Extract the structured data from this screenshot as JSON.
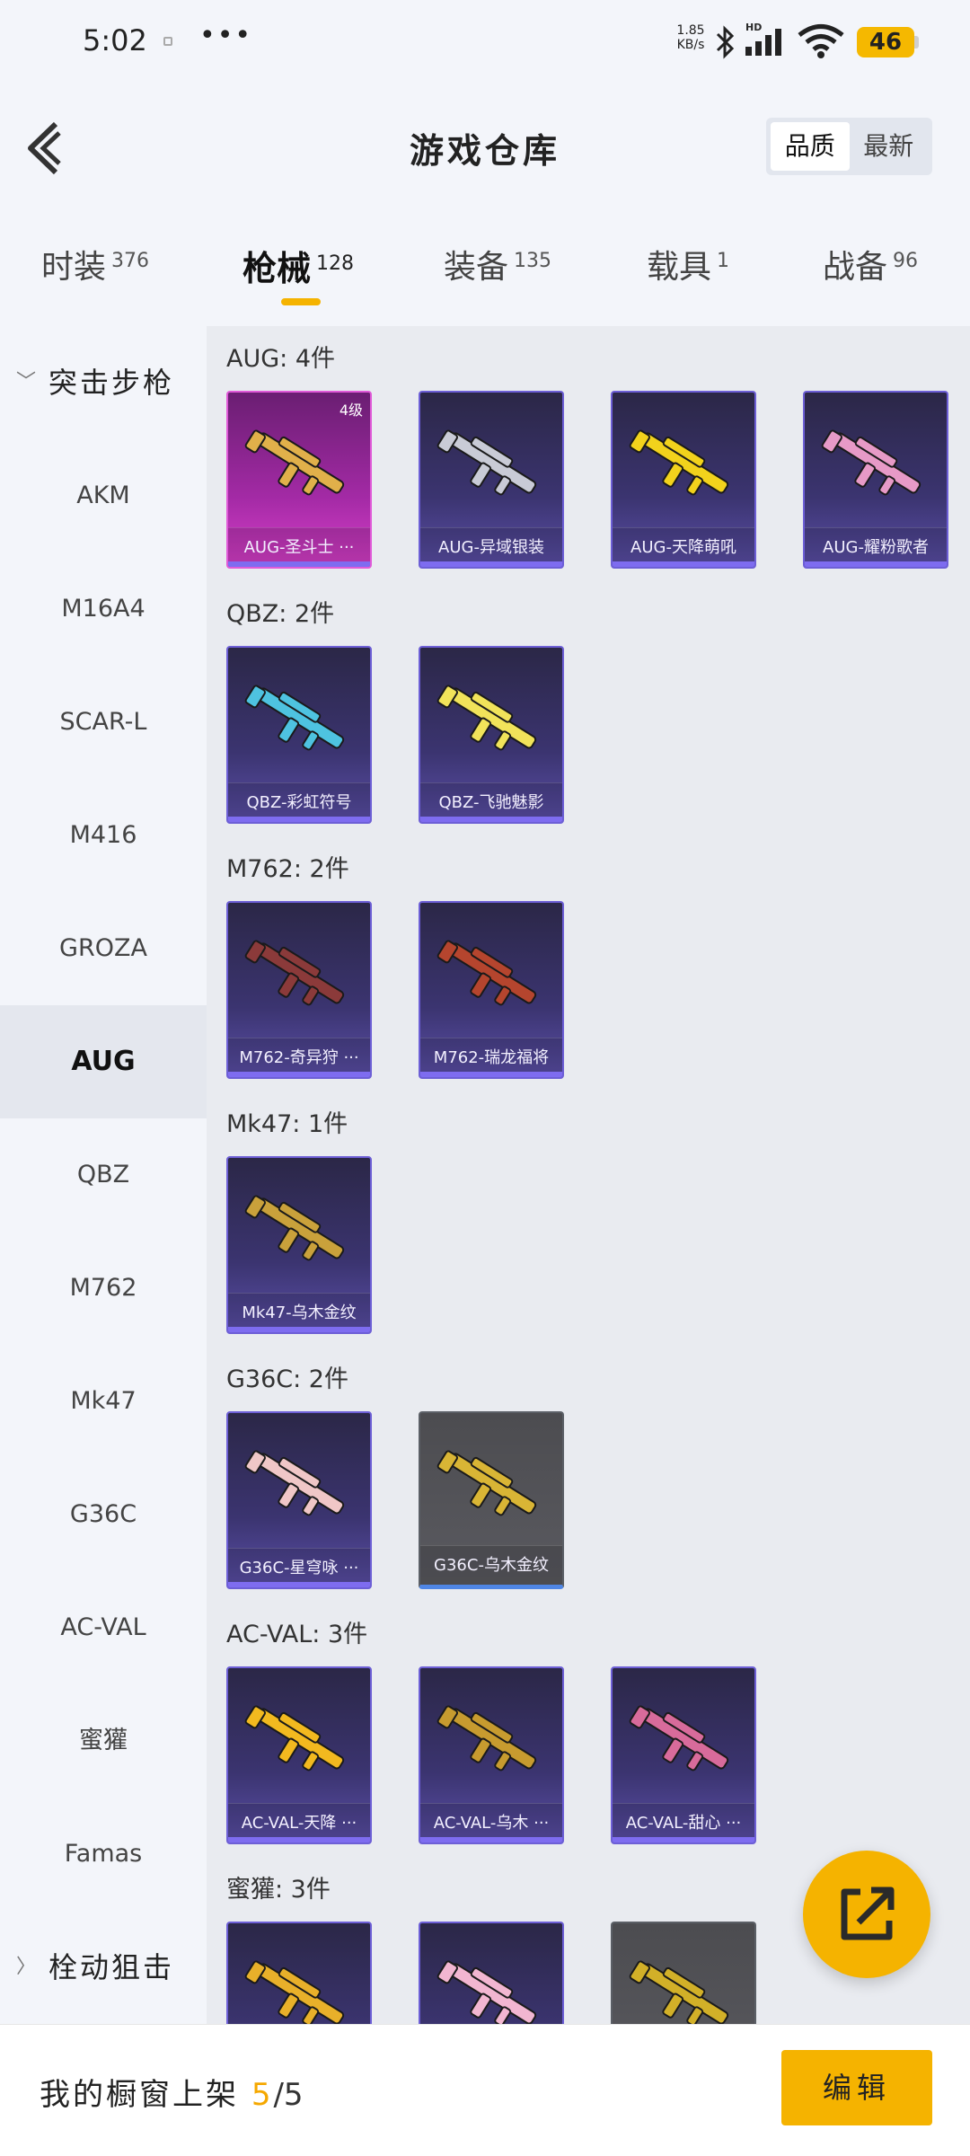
{
  "status_bar": {
    "time": "5:02",
    "more": "•••",
    "net_speed_value": "1.85",
    "net_speed_unit": "KB/s",
    "signal_hd": "HD",
    "battery": "46"
  },
  "header": {
    "title": "游戏仓库",
    "sort_options": [
      "品质",
      "最新"
    ],
    "active_sort": "品质"
  },
  "tabs": [
    {
      "label": "时装",
      "count": "376"
    },
    {
      "label": "枪械",
      "count": "128"
    },
    {
      "label": "装备",
      "count": "135"
    },
    {
      "label": "载具",
      "count": "1"
    },
    {
      "label": "战备",
      "count": "96"
    }
  ],
  "active_tab": "枪械",
  "sidebar": {
    "group_open": "突击步枪",
    "items": [
      "AKM",
      "M16A4",
      "SCAR-L",
      "M416",
      "GROZA",
      "AUG",
      "QBZ",
      "M762",
      "Mk47",
      "G36C",
      "AC-VAL",
      "蜜獾",
      "Famas"
    ],
    "active_item": "AUG",
    "group_closed": "栓动狙击"
  },
  "sections": [
    {
      "title": "AUG: 4件",
      "items": [
        {
          "name": "AUG-圣斗士 ···",
          "level": "4级",
          "style": "pink",
          "color": "#e0b04a"
        },
        {
          "name": "AUG-异域银装",
          "style": "purple",
          "color": "#c9cbd6"
        },
        {
          "name": "AUG-天降萌吼",
          "style": "purple",
          "color": "#f2d21c"
        },
        {
          "name": "AUG-耀粉歌者",
          "style": "purple",
          "color": "#e79ac7"
        }
      ]
    },
    {
      "title": "QBZ: 2件",
      "items": [
        {
          "name": "QBZ-彩虹符号",
          "style": "purple",
          "color": "#4ec3e0"
        },
        {
          "name": "QBZ-飞驰魅影",
          "style": "purple",
          "color": "#f1e35a"
        }
      ]
    },
    {
      "title": "M762: 2件",
      "items": [
        {
          "name": "M762-奇异狩 ···",
          "style": "purple",
          "color": "#8b3a3a"
        },
        {
          "name": "M762-瑞龙福将",
          "style": "purple",
          "color": "#b5452e"
        }
      ]
    },
    {
      "title": "Mk47: 1件",
      "items": [
        {
          "name": "Mk47-乌木金纹",
          "style": "purple",
          "color": "#c9a13b"
        }
      ]
    },
    {
      "title": "G36C: 2件",
      "items": [
        {
          "name": "G36C-星穹咏 ···",
          "style": "purple",
          "color": "#f0c7c7"
        },
        {
          "name": "G36C-乌木金纹",
          "style": "gray",
          "color": "#d9b535"
        }
      ]
    },
    {
      "title": "AC-VAL: 3件",
      "items": [
        {
          "name": "AC-VAL-天降 ···",
          "style": "purple",
          "color": "#f2b91f"
        },
        {
          "name": "AC-VAL-乌木 ···",
          "style": "purple",
          "color": "#c79b2f"
        },
        {
          "name": "AC-VAL-甜心 ···",
          "style": "purple",
          "color": "#d86b9b"
        }
      ]
    },
    {
      "title": "蜜獾: 3件",
      "items": [
        {
          "name": "",
          "style": "purple",
          "color": "#e8b02a"
        },
        {
          "name": "",
          "style": "purple",
          "color": "#f2b6d1"
        },
        {
          "name": "",
          "style": "gray",
          "color": "#d2b028"
        }
      ]
    }
  ],
  "bottom_bar": {
    "label": "我的橱窗上架",
    "count": "5",
    "total": "/5",
    "edit": "编辑"
  },
  "colors": {
    "accent": "#f5b300",
    "card_purple": "#3b3470",
    "card_pink": "#a32aa5",
    "card_gray": "#5a5a60"
  }
}
